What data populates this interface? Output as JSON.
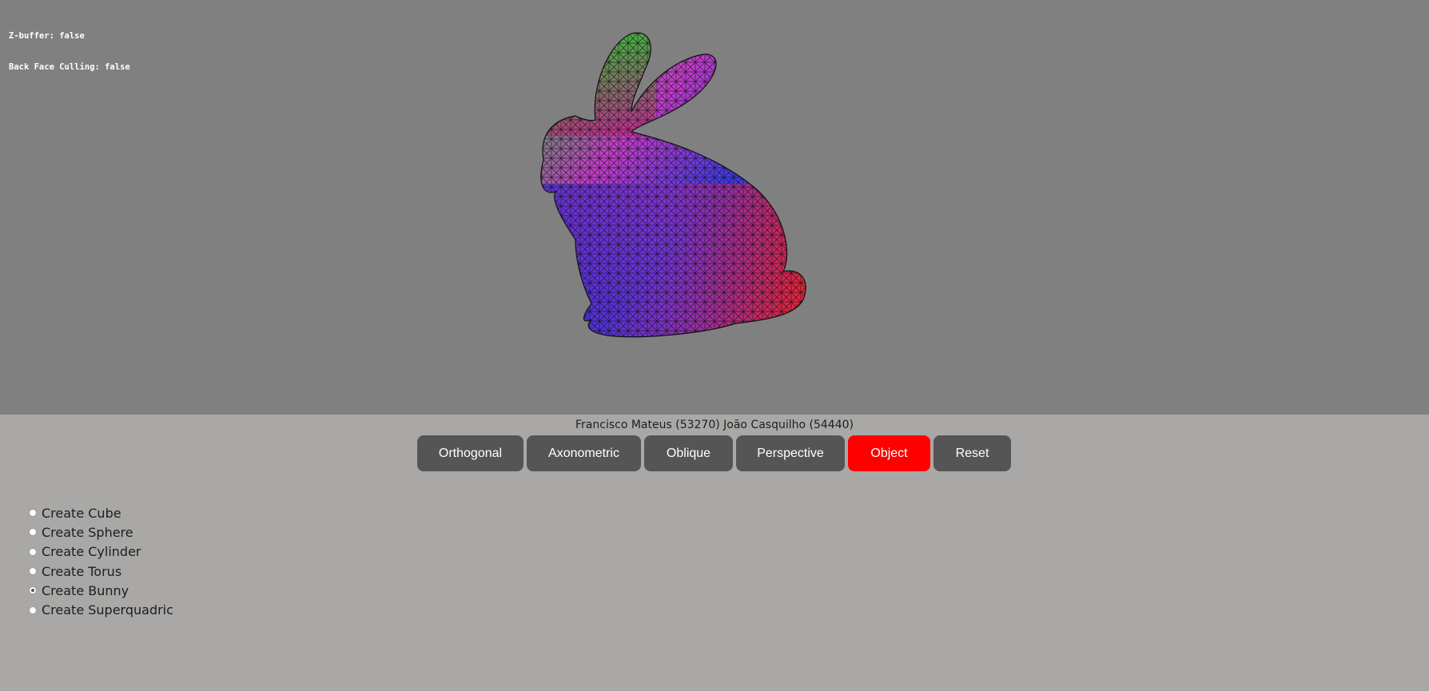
{
  "hud": {
    "zbuffer": "Z-buffer: false",
    "culling": "Back Face Culling: false"
  },
  "authors": "Francisco Mateus (53270) João Casquilho (54440)",
  "toolbar": {
    "buttons": [
      {
        "label": "Orthogonal",
        "active": false
      },
      {
        "label": "Axonometric",
        "active": false
      },
      {
        "label": "Oblique",
        "active": false
      },
      {
        "label": "Perspective",
        "active": false
      },
      {
        "label": "Object",
        "active": true
      },
      {
        "label": "Reset",
        "active": false
      }
    ]
  },
  "shapes": {
    "options": [
      {
        "label": "Create Cube",
        "checked": false
      },
      {
        "label": "Create Sphere",
        "checked": false
      },
      {
        "label": "Create Cylinder",
        "checked": false
      },
      {
        "label": "Create Torus",
        "checked": false
      },
      {
        "label": "Create Bunny",
        "checked": true
      },
      {
        "label": "Create Superquadric",
        "checked": false
      }
    ]
  },
  "colors": {
    "canvas_bg": "#808080",
    "panel_bg": "#a9a8a7",
    "button_bg": "#555555",
    "button_active": "#ff0000"
  }
}
